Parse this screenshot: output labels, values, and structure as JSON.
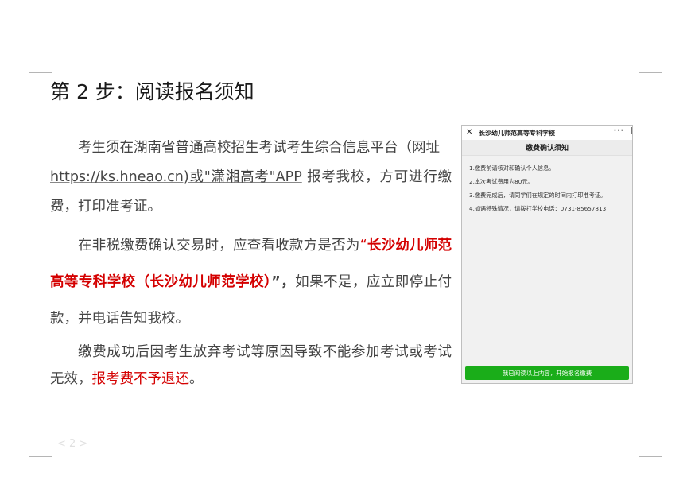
{
  "title": "第 2 步：阅读报名须知",
  "paragraph1": {
    "text_start": "考生须在湖南省普通高校招生考试考生综合信息平台（网址",
    "url": "https://ks.hneao.cn)或\"潇湘高考\"APP",
    "text_end": "报考我校，方可进行缴费，打印准考证。"
  },
  "paragraph2": {
    "text_start": "在非税缴费确认交易时，应查看收款方是否为",
    "quote_open": "“",
    "school_name": "长沙幼儿师范高等专科学校（长沙幼儿师范学校）",
    "quote_close": "”，",
    "text_end": "如果不是，应立即停止付款，并电话告知我校。"
  },
  "paragraph3": {
    "text_start": "缴费成功后因考生放弃考试等原因导致不能参加考试或考试无效，",
    "highlight": "报考费不予退还",
    "text_end": "。"
  },
  "page_number": "< 2 >",
  "phone": {
    "close_glyph": "✕",
    "app_title": "长沙幼儿师范高等专科学校",
    "more_glyph": "···",
    "heading": "缴费确认须知",
    "items": [
      "1.缴费前请核对和确认个人信息。",
      "2.本次考试费用为80元。",
      "3.缴费完成后，请同学们在规定的时间内打印准考证。",
      "4.如遇特殊情况，请拨打学校电话：0731-85657813"
    ],
    "confirm_button": "我已阅读以上内容，开始报名缴费"
  },
  "colors": {
    "highlight_red": "#d40000",
    "button_green": "#1aad19",
    "body_text": "#444444"
  }
}
